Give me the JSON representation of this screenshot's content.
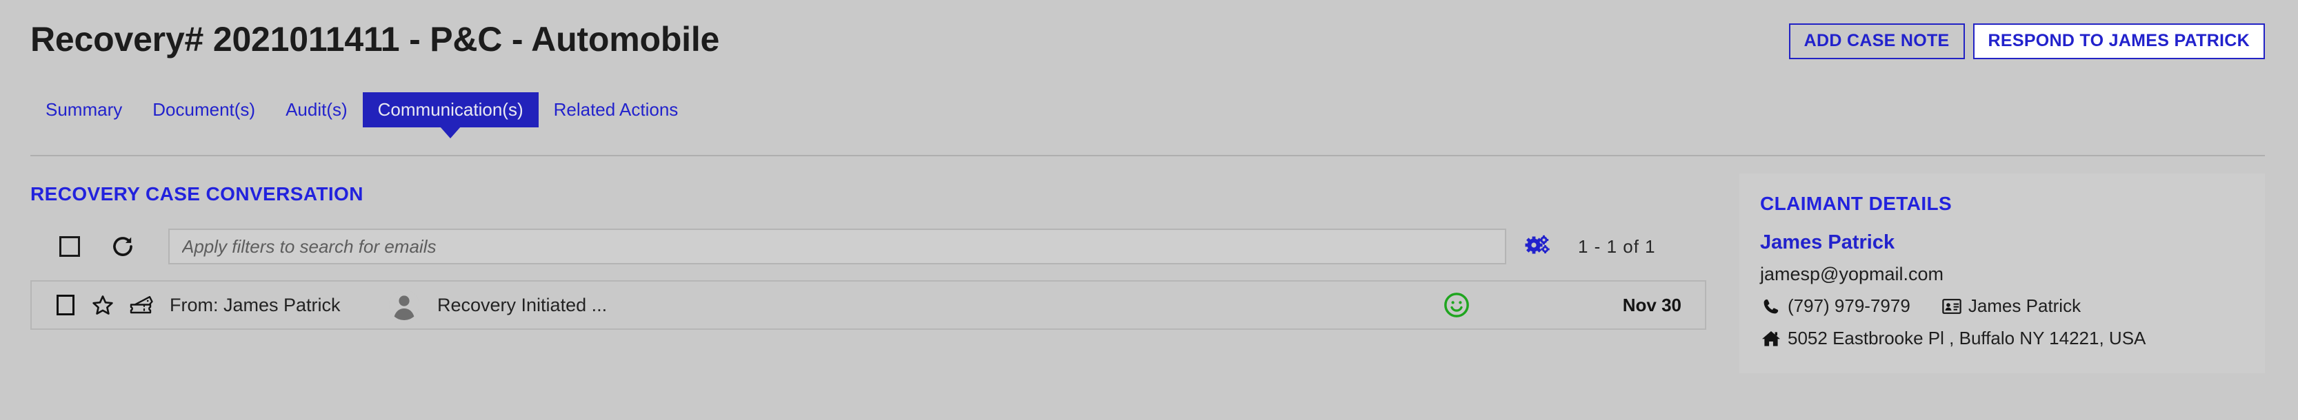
{
  "header": {
    "title": "Recovery# 2021011411 - P&C - Automobile",
    "buttons": [
      {
        "label": "ADD CASE NOTE",
        "style": "ghost"
      },
      {
        "label": "RESPOND TO JAMES PATRICK",
        "style": "white"
      }
    ]
  },
  "tabs": [
    {
      "label": "Summary",
      "active": false
    },
    {
      "label": "Document(s)",
      "active": false
    },
    {
      "label": "Audit(s)",
      "active": false
    },
    {
      "label": "Communication(s)",
      "active": true
    },
    {
      "label": "Related Actions",
      "active": false
    }
  ],
  "conversation": {
    "section_title": "RECOVERY CASE CONVERSATION",
    "toolbar": {
      "select_all_icon": "checkbox-icon",
      "refresh_icon": "refresh-icon",
      "settings_icon": "gears-icon",
      "search_placeholder": "Apply filters to search for emails",
      "search_value": "",
      "pagination": "1 - 1  of  1"
    },
    "rows": [
      {
        "checkbox_icon": "checkbox-icon",
        "star_icon": "star-outline-icon",
        "tag_icon": "ticket-icon",
        "from": "From: James Patrick",
        "avatar_icon": "user-avatar-icon",
        "subject": "Recovery Initiated ...",
        "sentiment_icon": "smiley-face-icon",
        "date": "Nov 30"
      }
    ]
  },
  "claimant": {
    "title": "CLAIMANT DETAILS",
    "name": "James Patrick",
    "email": "jamesp@yopmail.com",
    "phone_icon": "phone-icon",
    "phone": "(797) 979-7979",
    "contact_card_icon": "id-card-icon",
    "contact_name": "James Patrick",
    "address_icon": "home-icon",
    "address": "5052 Eastbrooke Pl , Buffalo NY 14221, USA"
  },
  "colors": {
    "page_background": "#c9c9c9",
    "accent_blue": "#2222cc",
    "active_tab_blue": "#2222bb",
    "sentiment_green": "#1fa51f",
    "panel_background": "#cdcdcd"
  }
}
